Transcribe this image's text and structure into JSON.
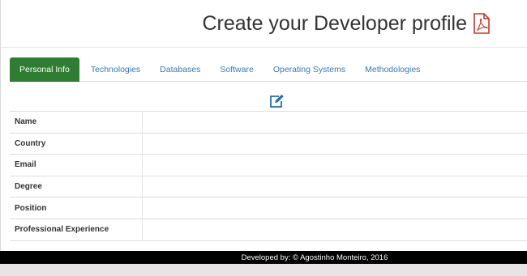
{
  "header": {
    "title": "Create your Developer profile",
    "pdf_icon": "file-pdf-icon"
  },
  "tabs": [
    {
      "label": "Personal Info",
      "active": true
    },
    {
      "label": "Technologies",
      "active": false
    },
    {
      "label": "Databases",
      "active": false
    },
    {
      "label": "Software",
      "active": false
    },
    {
      "label": "Operating Systems",
      "active": false
    },
    {
      "label": "Methodologies",
      "active": false
    }
  ],
  "edit_icon": "edit-icon",
  "profile": {
    "rows": [
      {
        "label": "Name",
        "value": ""
      },
      {
        "label": "Country",
        "value": ""
      },
      {
        "label": "Email",
        "value": ""
      },
      {
        "label": "Degree",
        "value": ""
      },
      {
        "label": "Position",
        "value": ""
      },
      {
        "label": "Professional Experience",
        "value": ""
      }
    ]
  },
  "footer": {
    "text": "Developed by: © Agostinho Monteiro, 2016"
  },
  "colors": {
    "active_tab": "#2e7d32",
    "link": "#337ab7",
    "pdf_icon": "#c0392b",
    "edit_icon": "#2a6fa8",
    "footer_bg": "#000000"
  }
}
